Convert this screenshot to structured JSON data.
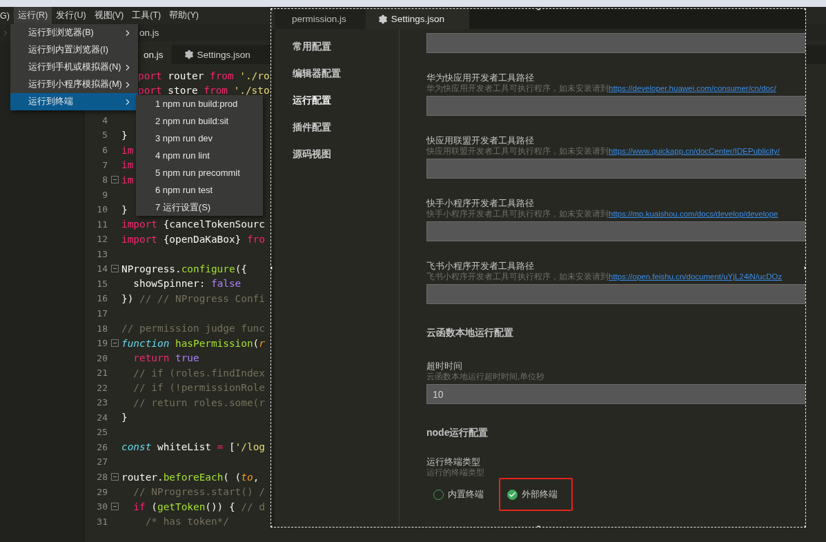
{
  "menu_bar": [
    {
      "label": "G)",
      "selected": false
    },
    {
      "label": "运行(R)",
      "selected": true
    },
    {
      "label": "发行(U)",
      "selected": false
    },
    {
      "label": "视图(V)",
      "selected": false
    },
    {
      "label": "工具(T)",
      "selected": false
    },
    {
      "label": "帮助(Y)",
      "selected": false
    }
  ],
  "run_menu": [
    {
      "label": "运行到浏览器(B)",
      "has_submenu": true,
      "selected": false
    },
    {
      "label": "运行到内置浏览器(I)",
      "has_submenu": false,
      "selected": false
    },
    {
      "label": "运行到手机或模拟器(N)",
      "has_submenu": true,
      "selected": false
    },
    {
      "label": "运行到小程序模拟器(M)",
      "has_submenu": true,
      "selected": false
    },
    {
      "label": "运行到终端",
      "has_submenu": true,
      "selected": true
    }
  ],
  "terminal_submenu": [
    "1 npm run build:prod",
    "2 npm run build:sit",
    "3 npm run dev",
    "4 npm run lint",
    "5 npm run precommit",
    "6 npm run test",
    "7 运行设置(S)"
  ],
  "breadcrumb": {
    "file": "on.js"
  },
  "editor_tabs": [
    {
      "label": "on.js",
      "selected": true
    },
    {
      "label": "Settings.json",
      "selected": false
    }
  ],
  "code_lines": [
    {
      "partial": true,
      "segments": [
        {
          "kind": "kw",
          "s": "port"
        },
        {
          "kind": "plain",
          "s": " router "
        },
        {
          "kind": "kw",
          "s": "from"
        },
        {
          "kind": "str",
          "s": " './ro"
        }
      ]
    },
    {
      "partial": true,
      "segments": [
        {
          "kind": "kw",
          "s": "port"
        },
        {
          "kind": "plain",
          "s": " store "
        },
        {
          "kind": "kw",
          "s": "from"
        },
        {
          "kind": "str",
          "s": " './sto"
        }
      ]
    },
    {
      "number": "4",
      "fold": false
    },
    {
      "number": "5",
      "fold": false,
      "partial": false,
      "segments": [
        {
          "kind": "plain",
          "s": "}"
        }
      ]
    },
    {
      "number": "6",
      "fold": false,
      "partial": false,
      "segments": [
        {
          "kind": "kw",
          "s": "im"
        }
      ]
    },
    {
      "number": "7",
      "fold": false,
      "partial": false,
      "segments": [
        {
          "kind": "kw",
          "s": "im"
        }
      ]
    },
    {
      "number": "8",
      "fold": true,
      "partial": false,
      "segments": [
        {
          "kind": "kw",
          "s": "im"
        }
      ]
    },
    {
      "number": "9",
      "fold": false
    },
    {
      "number": "10",
      "fold": false,
      "partial": false,
      "segments": [
        {
          "kind": "plain",
          "s": "}"
        }
      ]
    },
    {
      "number": "11",
      "fold": false,
      "partial": false,
      "segments": [
        {
          "kind": "kw",
          "s": "import"
        },
        {
          "kind": "plain",
          "s": " {cancelTokenSourc"
        }
      ]
    },
    {
      "number": "12",
      "fold": false,
      "partial": false,
      "segments": [
        {
          "kind": "kw",
          "s": "import"
        },
        {
          "kind": "plain",
          "s": " {openDaKaBox} "
        },
        {
          "kind": "kw",
          "s": "fro"
        }
      ]
    },
    {
      "number": "13",
      "fold": false
    },
    {
      "number": "14",
      "fold": true,
      "partial": false,
      "segments": [
        {
          "kind": "plain",
          "s": "NProgress."
        },
        {
          "kind": "fn",
          "s": "configure"
        },
        {
          "kind": "plain",
          "s": "({"
        }
      ]
    },
    {
      "number": "15",
      "fold": false,
      "partial": false,
      "segments": [
        {
          "kind": "plain",
          "s": "  showSpinner: "
        },
        {
          "kind": "const",
          "s": "false"
        }
      ]
    },
    {
      "number": "16",
      "fold": false,
      "partial": false,
      "segments": [
        {
          "kind": "plain",
          "s": "}) "
        },
        {
          "kind": "comment",
          "s": "// // NProgress Confi"
        }
      ]
    },
    {
      "number": "17",
      "fold": false
    },
    {
      "number": "18",
      "fold": false,
      "partial": false,
      "segments": [
        {
          "kind": "comment",
          "s": "// permission judge func"
        }
      ]
    },
    {
      "number": "19",
      "fold": true,
      "partial": false,
      "segments": [
        {
          "kind": "storage",
          "s": "function"
        },
        {
          "kind": "fn",
          "s": " hasPermission"
        },
        {
          "kind": "plain",
          "s": "("
        },
        {
          "kind": "param",
          "s": "r"
        }
      ]
    },
    {
      "number": "20",
      "fold": false,
      "partial": false,
      "segments": [
        {
          "kind": "kw",
          "s": "  return"
        },
        {
          "kind": "const",
          "s": " true"
        }
      ]
    },
    {
      "number": "21",
      "fold": false,
      "partial": false,
      "segments": [
        {
          "kind": "comment",
          "s": "  // if (roles.findIndex"
        }
      ]
    },
    {
      "number": "22",
      "fold": false,
      "partial": false,
      "segments": [
        {
          "kind": "comment",
          "s": "  // if (!permissionRole"
        }
      ]
    },
    {
      "number": "23",
      "fold": false,
      "partial": false,
      "segments": [
        {
          "kind": "comment",
          "s": "  // return roles.some(r"
        }
      ]
    },
    {
      "number": "24",
      "fold": false,
      "partial": false,
      "segments": [
        {
          "kind": "plain",
          "s": "}"
        }
      ]
    },
    {
      "number": "25",
      "fold": false
    },
    {
      "number": "26",
      "fold": false,
      "partial": false,
      "segments": [
        {
          "kind": "storage",
          "s": "const"
        },
        {
          "kind": "plain",
          "s": " whiteList "
        },
        {
          "kind": "kw",
          "s": "="
        },
        {
          "kind": "plain",
          "s": " ["
        },
        {
          "kind": "str",
          "s": "'/log"
        }
      ]
    },
    {
      "number": "27",
      "fold": false
    },
    {
      "number": "28",
      "fold": true,
      "partial": false,
      "segments": [
        {
          "kind": "plain",
          "s": "router."
        },
        {
          "kind": "fn",
          "s": "beforeEach"
        },
        {
          "kind": "plain",
          "s": "( ("
        },
        {
          "kind": "param",
          "s": "to"
        },
        {
          "kind": "plain",
          "s": ","
        }
      ]
    },
    {
      "number": "29",
      "fold": false,
      "partial": false,
      "segments": [
        {
          "kind": "comment",
          "s": "  // NProgress.start() /"
        }
      ]
    },
    {
      "number": "30",
      "fold": true,
      "partial": false,
      "segments": [
        {
          "kind": "kw",
          "s": "  if"
        },
        {
          "kind": "plain",
          "s": " ("
        },
        {
          "kind": "fn",
          "s": "getToken"
        },
        {
          "kind": "plain",
          "s": "()) { "
        },
        {
          "kind": "comment",
          "s": "// d"
        }
      ]
    },
    {
      "number": "31",
      "fold": false,
      "partial": false,
      "segments": [
        {
          "kind": "comment",
          "s": "    /* has token*/"
        }
      ]
    }
  ],
  "settings_window": {
    "tabs": [
      {
        "label": "permission.js",
        "selected": false
      },
      {
        "label": "Settings.json",
        "selected": true
      }
    ],
    "nav": [
      {
        "label": "常用配置",
        "selected": false
      },
      {
        "label": "编辑器配置",
        "selected": false
      },
      {
        "label": "运行配置",
        "selected": true
      },
      {
        "label": "插件配置",
        "selected": false
      },
      {
        "label": "源码视图",
        "selected": false
      }
    ],
    "items": [
      {
        "kind": "field"
      },
      {
        "kind": "path",
        "label": "华为快应用开发者工具路径",
        "description": "华为快应用开发者工具可执行程序，如未安装请到",
        "link": "https://developer.huawei.com/consumer/cn/doc/"
      },
      {
        "kind": "path",
        "label": "快应用联盟开发者工具路径",
        "description": "快应用联盟开发者工具可执行程序，如未安装请到",
        "link": "https://www.quickapp.cn/docCenter/IDEPublicity/"
      },
      {
        "kind": "path",
        "label": "快手小程序开发者工具路径",
        "description": "快手小程序开发者工具可执行程序，如未安装请到",
        "link": "https://mp.kuaishou.com/docs/develop/develope"
      },
      {
        "kind": "path",
        "label": "飞书小程序开发者工具路径",
        "description": "飞书小程序开发者工具可执行程序，如未安装请到",
        "link": "https://open.feishu.cn/document/uYjL24iN/ucDOz"
      },
      {
        "kind": "heading",
        "label": "云函数本地运行配置"
      },
      {
        "kind": "value",
        "label": "超时时间",
        "description": "云函数本地运行超时时间,单位秒",
        "value": "10"
      },
      {
        "kind": "heading",
        "label": "node运行配置"
      },
      {
        "kind": "radio",
        "label": "运行终端类型",
        "description": "运行的终端类型",
        "options": [
          {
            "label": "内置终端",
            "selected": false,
            "highlighted": false
          },
          {
            "label": "外部终端",
            "selected": true,
            "highlighted": true
          }
        ]
      }
    ]
  }
}
